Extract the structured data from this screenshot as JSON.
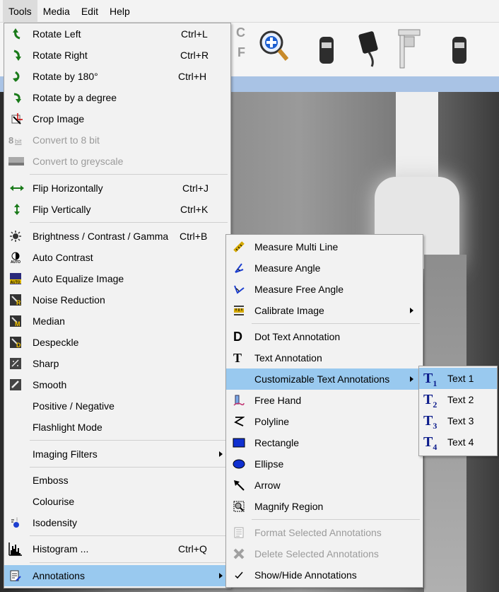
{
  "menubar": {
    "items": [
      "Tools",
      "Media",
      "Edit",
      "Help"
    ]
  },
  "toolbar": {
    "letters": [
      "C",
      "F"
    ]
  },
  "tools_menu": {
    "items": [
      {
        "label": "Rotate Left",
        "shortcut": "Ctrl+L",
        "icon": "rotate-left-icon"
      },
      {
        "label": "Rotate Right",
        "shortcut": "Ctrl+R",
        "icon": "rotate-right-icon"
      },
      {
        "label": "Rotate by 180°",
        "shortcut": "Ctrl+H",
        "icon": "rotate-180-icon"
      },
      {
        "label": "Rotate by a degree",
        "shortcut": "",
        "icon": "rotate-degree-icon"
      },
      {
        "label": "Crop Image",
        "shortcut": "",
        "icon": "crop-icon"
      },
      {
        "label": "Convert to 8 bit",
        "shortcut": "",
        "icon": "8bit-icon"
      },
      {
        "label": "Convert to greyscale",
        "shortcut": "",
        "icon": "greyscale-icon"
      },
      {
        "label": "Flip Horizontally",
        "shortcut": "Ctrl+J",
        "icon": "flip-horizontal-icon"
      },
      {
        "label": "Flip Vertically",
        "shortcut": "Ctrl+K",
        "icon": "flip-vertical-icon"
      },
      {
        "label": "Brightness / Contrast / Gamma",
        "shortcut": "Ctrl+B",
        "icon": "brightness-icon"
      },
      {
        "label": "Auto Contrast",
        "shortcut": "",
        "icon": "auto-contrast-icon"
      },
      {
        "label": "Auto Equalize Image",
        "shortcut": "",
        "icon": "auto-equalize-icon"
      },
      {
        "label": "Noise Reduction",
        "shortcut": "",
        "icon": "noise-reduction-icon"
      },
      {
        "label": "Median",
        "shortcut": "",
        "icon": "median-icon"
      },
      {
        "label": "Despeckle",
        "shortcut": "",
        "icon": "despeckle-icon"
      },
      {
        "label": "Sharp",
        "shortcut": "",
        "icon": "sharp-icon"
      },
      {
        "label": "Smooth",
        "shortcut": "",
        "icon": "smooth-icon"
      },
      {
        "label": "Positive / Negative",
        "shortcut": "",
        "icon": ""
      },
      {
        "label": "Flashlight Mode",
        "shortcut": "",
        "icon": ""
      },
      {
        "label": "Imaging Filters",
        "shortcut": "",
        "icon": ""
      },
      {
        "label": "Emboss",
        "shortcut": "",
        "icon": ""
      },
      {
        "label": "Colourise",
        "shortcut": "",
        "icon": ""
      },
      {
        "label": "Isodensity",
        "shortcut": "",
        "icon": "isodensity-icon"
      },
      {
        "label": "Histogram ...",
        "shortcut": "Ctrl+Q",
        "icon": "histogram-icon"
      },
      {
        "label": "Annotations",
        "shortcut": "",
        "icon": "annotations-icon"
      }
    ]
  },
  "annotations_menu": {
    "items": [
      {
        "label": "Measure Multi Line"
      },
      {
        "label": "Measure Angle"
      },
      {
        "label": "Measure Free Angle"
      },
      {
        "label": "Calibrate Image"
      },
      {
        "label": "Dot Text Annotation"
      },
      {
        "label": "Text Annotation"
      },
      {
        "label": "Customizable Text Annotations"
      },
      {
        "label": "Free Hand"
      },
      {
        "label": "Polyline"
      },
      {
        "label": "Rectangle"
      },
      {
        "label": "Ellipse"
      },
      {
        "label": "Arrow"
      },
      {
        "label": "Magnify Region"
      },
      {
        "label": "Format Selected Annotations"
      },
      {
        "label": "Delete Selected Annotations"
      },
      {
        "label": "Show/Hide Annotations"
      }
    ]
  },
  "text_menu": {
    "items": [
      {
        "label": "Text 1",
        "icon_text": "T",
        "sub": "1"
      },
      {
        "label": "Text 2",
        "icon_text": "T",
        "sub": "2"
      },
      {
        "label": "Text 3",
        "icon_text": "T",
        "sub": "3"
      },
      {
        "label": "Text 4",
        "icon_text": "T",
        "sub": "4"
      }
    ]
  },
  "colors": {
    "highlight": "#99c9ef",
    "menu_bg": "#f2f2f2",
    "arrow_green": "#1a7a1a"
  }
}
